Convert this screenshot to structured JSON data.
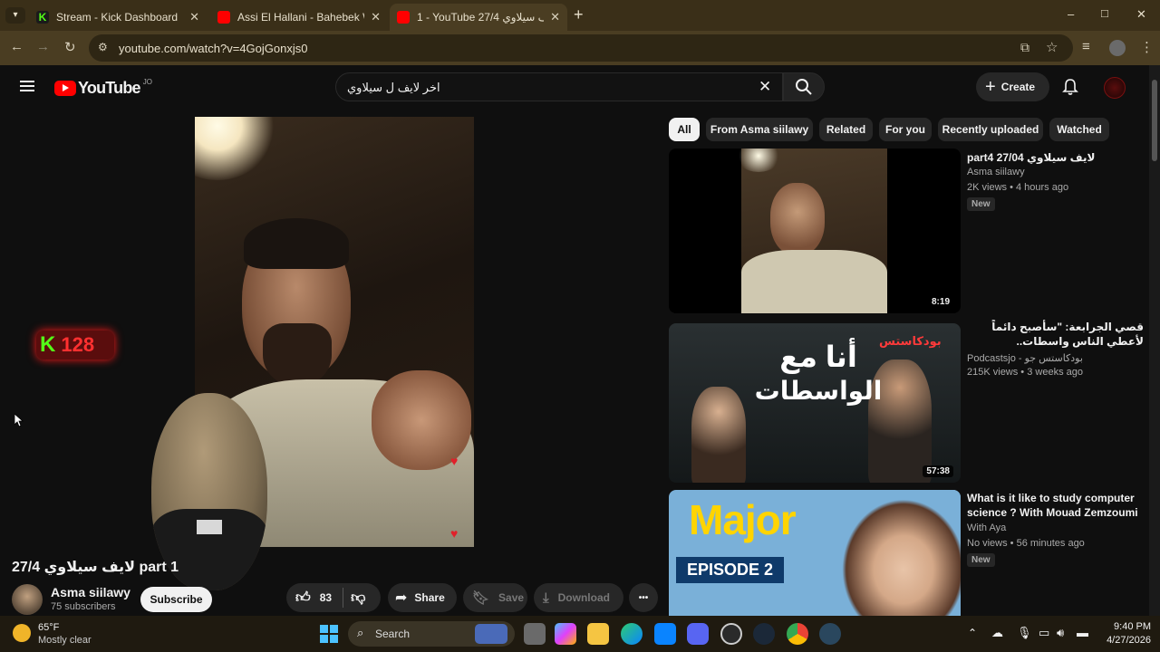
{
  "browser": {
    "tabs": [
      {
        "title": "Stream - Kick Dashboard",
        "favicon_color": "#53fc18"
      },
      {
        "title": "Assi El Hallani - Bahebek We Bg",
        "favicon_color": "#ff0000"
      },
      {
        "title": "1 - YouTube 27/4 لايف سيلاوي",
        "favicon_color": "#ff0000",
        "active": true
      }
    ],
    "new_tab": "+",
    "url": "youtube.com/watch?v=4GojGonxjs0",
    "window_controls": {
      "minimize": "–",
      "maximize": "□",
      "close": "✕"
    }
  },
  "youtube": {
    "logo_text": "YouTube",
    "country_code": "JO",
    "search_query": "اخر لايف ل سيلاوي",
    "create_label": "Create",
    "chips": [
      "All",
      "From Asma siilawy",
      "Related",
      "For you",
      "Recently uploaded",
      "Watched"
    ],
    "video": {
      "title": "27/4 لايف سيلاوي part 1",
      "channel": "Asma siilawy",
      "subscribers": "75 subscribers",
      "subscribe_label": "Subscribe",
      "likes": "83",
      "share_label": "Share",
      "save_label": "Save",
      "download_label": "Download",
      "more_label": "•••"
    },
    "overlay": {
      "kick_count": "128"
    },
    "recommendations": [
      {
        "title": "part4 27/04 لايف سيلاوي",
        "channel": "Asma siilawy",
        "meta": "2K views • 4 hours ago",
        "badge": "New",
        "duration": "8:19"
      },
      {
        "title": "قصي الجرابعة: \"سأصبح دائماً لأعطي الناس واسطات.. وشهرتي بدأت بصدفة\" | ما وراء ...",
        "channel": "Podcastsjo - بودكاستس جو",
        "meta": "215K views • 3 weeks ago",
        "badge": "",
        "duration": "57:38",
        "thumb_text_main": "أنا مع",
        "thumb_text_sub": "الواسطات",
        "thumb_brand": "بودكاستس"
      },
      {
        "title": "What is it like to study computer science ? With Mouad Zemzoumi ...",
        "channel": "With Aya",
        "meta": "No views • 56 minutes ago",
        "badge": "New",
        "duration": "",
        "thumb_text_main": "Major",
        "thumb_text_sub": "EPISODE 2"
      }
    ]
  },
  "taskbar": {
    "weather_temp": "65°F",
    "weather_desc": "Mostly clear",
    "search_label": "Search",
    "time": "9:40 PM",
    "date": "4/27/2026"
  },
  "colors": {
    "youtube_red": "#ff0000",
    "kick_green": "#53fc18",
    "chrome_bg": "#4a3d22",
    "page_bg": "#0f0f0f"
  }
}
